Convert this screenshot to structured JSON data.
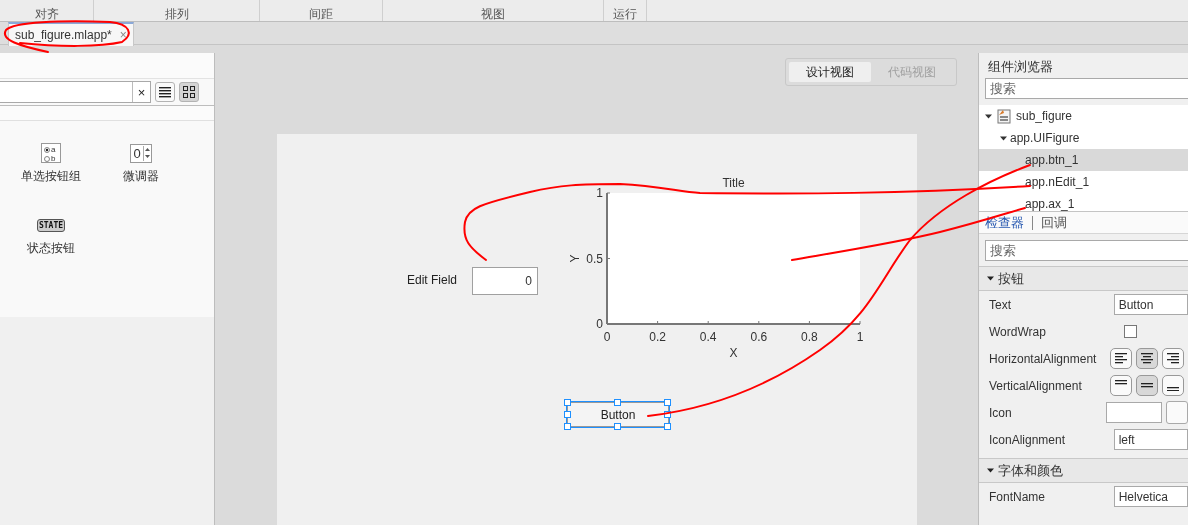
{
  "toolstrip": {
    "sections": [
      "对齐",
      "排列",
      "间距",
      "视图",
      "运行"
    ]
  },
  "tabs": [
    {
      "label": "sub_figure.mlapp*",
      "selected": true,
      "close": "×"
    }
  ],
  "library": {
    "search": {
      "clear": "×"
    },
    "view_modes": [
      {
        "kind": "list",
        "selected": false
      },
      {
        "kind": "grid",
        "selected": true
      }
    ],
    "components": [
      {
        "kind": "radio-group",
        "label": "单选按钮组",
        "icon_texts": [
          "a",
          "b"
        ]
      },
      {
        "kind": "spinner",
        "label": "微调器",
        "icon_texts": [
          "0"
        ]
      },
      {
        "kind": "state-button",
        "label": "状态按钮",
        "icon_texts": [
          "STATE"
        ]
      }
    ]
  },
  "view_toggle": [
    {
      "label": "设计视图",
      "selected": true
    },
    {
      "label": "代码视图",
      "selected": false
    }
  ],
  "canvas": {
    "edit_field": {
      "label": "Edit Field",
      "value": "0"
    },
    "axes": {
      "chart_data": {
        "type": "line",
        "title": "Title",
        "xlabel": "X",
        "ylabel": "Y",
        "xlim": [
          0,
          1
        ],
        "ylim": [
          0,
          1
        ],
        "xticks": [
          0,
          0.2,
          0.4,
          0.6,
          0.8,
          1
        ],
        "yticks": [
          0,
          0.5,
          1
        ]
      }
    },
    "button": {
      "text": "Button",
      "selected": true
    }
  },
  "browser": {
    "title": "组件浏览器",
    "search": {
      "placeholder": "搜索"
    },
    "tree": [
      {
        "label": "sub_figure",
        "expanded": true,
        "selected": false,
        "children": [
          {
            "label": "app.UIFigure",
            "expanded": true,
            "selected": false,
            "children": [
              {
                "label": "app.btn_1",
                "selected": true
              },
              {
                "label": "app.nEdit_1",
                "selected": false
              },
              {
                "label": "app.ax_1",
                "selected": false
              }
            ]
          }
        ]
      }
    ]
  },
  "inspector": {
    "tabs": [
      {
        "label": "检查器",
        "selected": true
      },
      {
        "label": "回调",
        "selected": false
      }
    ],
    "search": {
      "placeholder": "搜索"
    },
    "sections": [
      {
        "title": "按钮",
        "expanded": true,
        "properties": [
          {
            "kind": "text",
            "name": "Text",
            "value": "Button"
          },
          {
            "kind": "checkbox",
            "name": "WordWrap",
            "checked": false
          },
          {
            "kind": "align",
            "name": "HorizontalAlignment",
            "options": [
              {
                "kind": "left",
                "selected": false
              },
              {
                "kind": "center",
                "selected": true
              },
              {
                "kind": "right",
                "selected": false
              }
            ]
          },
          {
            "kind": "align",
            "name": "VerticalAlignment",
            "options": [
              {
                "kind": "top",
                "selected": false
              },
              {
                "kind": "middle",
                "selected": true
              },
              {
                "kind": "bottom",
                "selected": false
              }
            ]
          },
          {
            "kind": "file",
            "name": "Icon"
          },
          {
            "kind": "dropdown",
            "name": "IconAlignment",
            "value": "left"
          }
        ]
      },
      {
        "title": "字体和颜色",
        "expanded": true,
        "properties": [
          {
            "kind": "text",
            "name": "FontName",
            "value": "Helvetica"
          }
        ]
      }
    ]
  }
}
